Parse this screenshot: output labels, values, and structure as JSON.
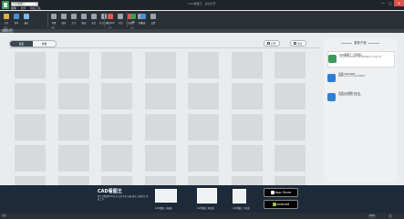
{
  "window": {
    "title": "CAD看图王 - 最近打开",
    "search_value": "CAD看图王",
    "minimize": "—",
    "maximize": "▢",
    "close": "✕"
  },
  "menu": [
    {
      "label": "常用",
      "active": true
    },
    {
      "label": "文件"
    },
    {
      "label": "标注工具"
    }
  ],
  "toolbar": {
    "groups": [
      {
        "label": "文件",
        "tools": [
          {
            "label": "打开",
            "icon": "folder-open-icon",
            "color": "#e0b04a"
          },
          {
            "label": "保存",
            "icon": "save-icon",
            "color": "#4a90d9"
          },
          {
            "label": "最近",
            "icon": "recent-icon",
            "color": "#7fb9e6"
          }
        ]
      },
      {
        "label": "编辑",
        "tools": [
          {
            "label": "测量",
            "icon": "measure-icon",
            "color": "#9aa3ad"
          },
          {
            "label": "缩放",
            "icon": "zoom-icon",
            "color": "#9aa3ad"
          },
          {
            "label": "文字",
            "icon": "text-icon",
            "color": "#9aa3ad"
          },
          {
            "label": "图层",
            "icon": "layers-icon",
            "color": "#9aa3ad"
          },
          {
            "label": "批注",
            "icon": "comment-icon",
            "color": "#9aa3ad"
          },
          {
            "label": "标注工具",
            "icon": "annotate-icon",
            "color": "#9aa3ad"
          }
        ]
      },
      {
        "label": "工具",
        "tools": [
          {
            "label": "导出PDF",
            "icon": "pdf-icon",
            "color": "#e05a4f"
          },
          {
            "label": "打印",
            "icon": "print-icon",
            "color": "#9aa3ad"
          },
          {
            "label": "导出图片",
            "icon": "image-export-icon",
            "color": "#e05a4f"
          },
          {
            "label": "转换",
            "icon": "convert-icon",
            "color": "#9aa3ad"
          }
        ]
      },
      {
        "label": "会员",
        "tools": [
          {
            "label": "VIP",
            "icon": "vip-icon",
            "color": "#3d9a5a"
          },
          {
            "label": "云盘",
            "icon": "cloud-icon",
            "color": "#4a90d9"
          },
          {
            "label": "设置",
            "icon": "gear-icon",
            "color": "#9aa3ad"
          }
        ]
      }
    ]
  },
  "doc_tab": "最近打开",
  "filters": [
    "最近",
    "收藏"
  ],
  "actions": {
    "open": "打开",
    "clear": "清空"
  },
  "thumbnails": {
    "rows": 5,
    "cols": 7
  },
  "side_panel": {
    "title": "更多产品",
    "products": [
      {
        "name": "CAD看图王（手机版）",
        "desc": "支持DWG/DXF等格式 随时随地看图 标注 测量 分享",
        "icon": "mobile-app-icon",
        "color": "#3d9a5a",
        "card": true
      },
      {
        "name": "浩辰CAD 2019",
        "desc": "兼容AutoCAD 专业设计绘图软件",
        "icon": "gstarcad-icon",
        "color": "#2f7fd1"
      },
      {
        "name": "浩辰CAD建筑 2019",
        "desc": "专业建筑设计软件 高效出图",
        "icon": "gstarcad-arch-icon",
        "color": "#2f7fd1"
      }
    ]
  },
  "banner": {
    "brand": "CAD看图王",
    "sub": "跨平台看图DWG文件 支持手机 电脑 网页 无缝同步 轻松工作",
    "devices": [
      "CAD看图王 电脑版",
      "CAD看图王 网页版",
      "CAD看图王 手机版"
    ],
    "stores": [
      {
        "label": "App Store",
        "icon": "apple-icon"
      },
      {
        "label": "android",
        "icon": "android-icon"
      }
    ]
  },
  "status": {
    "text": "就绪",
    "zoom_a": "100%",
    "zoom_b": "□"
  }
}
